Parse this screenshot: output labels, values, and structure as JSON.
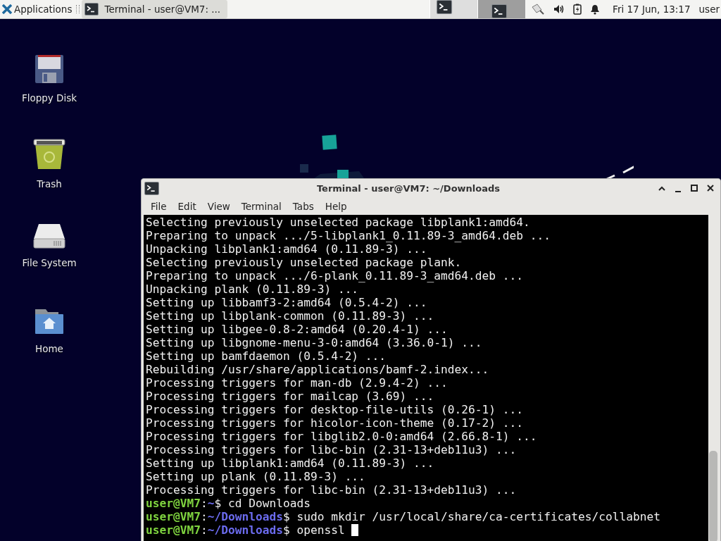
{
  "panel": {
    "app_menu": "Applications",
    "tasks": [
      {
        "label": "Terminal - user@VM7: ...",
        "selected": true
      }
    ],
    "workspaces": [
      {
        "selected": false,
        "has_window": true
      },
      {
        "selected": true,
        "has_window": true
      }
    ],
    "clock": "Fri 17 Jun, 13:17",
    "user": "user"
  },
  "desktop_icons": [
    {
      "kind": "floppy",
      "label": "Floppy Disk"
    },
    {
      "kind": "trash",
      "label": "Trash"
    },
    {
      "kind": "drive",
      "label": "File System"
    },
    {
      "kind": "home",
      "label": "Home"
    }
  ],
  "terminal": {
    "title": "Terminal - user@VM7: ~/Downloads",
    "menu": [
      "File",
      "Edit",
      "View",
      "Terminal",
      "Tabs",
      "Help"
    ],
    "lines": [
      {
        "kind": "output",
        "text": "Selecting previously unselected package libplank1:amd64."
      },
      {
        "kind": "output",
        "text": "Preparing to unpack .../5-libplank1_0.11.89-3_amd64.deb ..."
      },
      {
        "kind": "output",
        "text": "Unpacking libplank1:amd64 (0.11.89-3) ..."
      },
      {
        "kind": "output",
        "text": "Selecting previously unselected package plank."
      },
      {
        "kind": "output",
        "text": "Preparing to unpack .../6-plank_0.11.89-3_amd64.deb ..."
      },
      {
        "kind": "output",
        "text": "Unpacking plank (0.11.89-3) ..."
      },
      {
        "kind": "output",
        "text": "Setting up libbamf3-2:amd64 (0.5.4-2) ..."
      },
      {
        "kind": "output",
        "text": "Setting up libplank-common (0.11.89-3) ..."
      },
      {
        "kind": "output",
        "text": "Setting up libgee-0.8-2:amd64 (0.20.4-1) ..."
      },
      {
        "kind": "output",
        "text": "Setting up libgnome-menu-3-0:amd64 (3.36.0-1) ..."
      },
      {
        "kind": "output",
        "text": "Setting up bamfdaemon (0.5.4-2) ..."
      },
      {
        "kind": "output",
        "text": "Rebuilding /usr/share/applications/bamf-2.index..."
      },
      {
        "kind": "output",
        "text": "Processing triggers for man-db (2.9.4-2) ..."
      },
      {
        "kind": "output",
        "text": "Processing triggers for mailcap (3.69) ..."
      },
      {
        "kind": "output",
        "text": "Processing triggers for desktop-file-utils (0.26-1) ..."
      },
      {
        "kind": "output",
        "text": "Processing triggers for hicolor-icon-theme (0.17-2) ..."
      },
      {
        "kind": "output",
        "text": "Processing triggers for libglib2.0-0:amd64 (2.66.8-1) ..."
      },
      {
        "kind": "output",
        "text": "Processing triggers for libc-bin (2.31-13+deb11u3) ..."
      },
      {
        "kind": "output",
        "text": "Setting up libplank1:amd64 (0.11.89-3) ..."
      },
      {
        "kind": "output",
        "text": "Setting up plank (0.11.89-3) ..."
      },
      {
        "kind": "output",
        "text": "Processing triggers for libc-bin (2.31-13+deb11u3) ..."
      },
      {
        "kind": "prompt",
        "user": "user@VM7",
        "sep": ":",
        "path": "~",
        "command": "$ cd Downloads",
        "cursor": false
      },
      {
        "kind": "prompt",
        "user": "user@VM7",
        "sep": ":",
        "path": "~/Downloads",
        "command": "$ sudo mkdir /usr/local/share/ca-certificates/collabnet",
        "cursor": false
      },
      {
        "kind": "prompt",
        "user": "user@VM7",
        "sep": ":",
        "path": "~/Downloads",
        "command": "$ openssl ",
        "cursor": true
      }
    ]
  }
}
